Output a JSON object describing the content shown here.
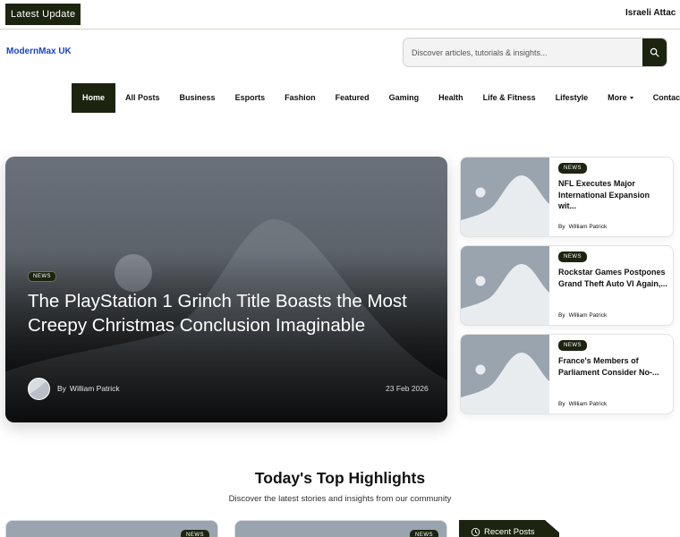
{
  "ticker": {
    "label": "Latest Update",
    "text": "Israeli Attac"
  },
  "site": {
    "logo": "ModernMax UK"
  },
  "search": {
    "placeholder": "Discover articles, tutorials & insights...",
    "icon": "search-icon"
  },
  "nav": {
    "items": [
      "Home",
      "All Posts",
      "Business",
      "Esports",
      "Fashion",
      "Featured",
      "Gaming",
      "Health",
      "Life & Fitness",
      "Lifestyle",
      "More",
      "Contact Us"
    ],
    "active": "Home"
  },
  "hero": {
    "badge": "NEWS",
    "title": "The PlayStation 1 Grinch Title Boasts the Most Creepy Christmas Conclusion Imaginable",
    "by": "By",
    "author": "William Patrick",
    "date": "23 Feb 2026"
  },
  "side_posts": [
    {
      "badge": "NEWS",
      "title": "NFL Executes Major International Expansion wit...",
      "by": "By",
      "author": "William Patrick"
    },
    {
      "badge": "NEWS",
      "title": "Rockstar Games Postpones Grand Theft Auto VI Again,...",
      "by": "By",
      "author": "William Patrick"
    },
    {
      "badge": "NEWS",
      "title": "France's Members of Parliament Consider No-...",
      "by": "By",
      "author": "William Patrick"
    }
  ],
  "highlights": {
    "title": "Today's Top Highlights",
    "subtitle": "Discover the latest stories and insights from our community",
    "cards": [
      {
        "badge": "NEWS"
      },
      {
        "badge": "NEWS"
      }
    ],
    "recent_label": "Recent Posts"
  },
  "colors": {
    "brand_dark": "#1c2410",
    "logo_blue": "#1a44c8"
  }
}
